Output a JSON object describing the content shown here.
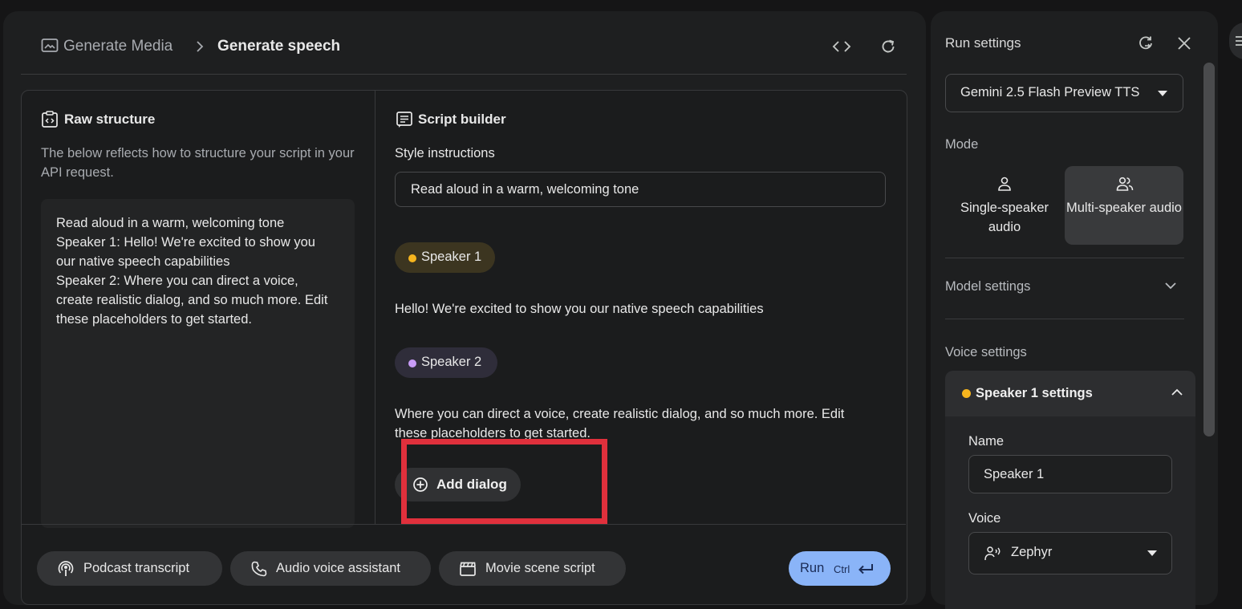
{
  "breadcrumb": {
    "parent": "Generate Media",
    "current": "Generate speech"
  },
  "raw_structure": {
    "title": "Raw structure",
    "description": "The below reflects how to structure your script in your API request.",
    "content_lines": [
      "Read aloud in a warm, welcoming tone",
      "Speaker 1: Hello! We're excited to show you our native speech capabilities",
      "Speaker 2: Where you can direct a voice, create realistic dialog, and so much more. Edit these placeholders to get started."
    ]
  },
  "script_builder": {
    "title": "Script builder",
    "style_label": "Style instructions",
    "style_value": "Read aloud in a warm, welcoming tone",
    "dialogs": [
      {
        "speaker": "Speaker 1",
        "dot_color": "#f6b51e",
        "text": "Hello! We're excited to show you our native speech capabilities"
      },
      {
        "speaker": "Speaker 2",
        "dot_color": "#c89cf7",
        "text": "Where you can direct a voice, create realistic dialog, and so much more. Edit these placeholders to get started."
      }
    ],
    "add_dialog_label": "Add dialog"
  },
  "presets": [
    {
      "label": "Podcast transcript",
      "icon": "podcast-icon"
    },
    {
      "label": "Audio voice assistant",
      "icon": "phone-icon"
    },
    {
      "label": "Movie scene script",
      "icon": "clapperboard-icon"
    }
  ],
  "run": {
    "label": "Run",
    "shortcut": "Ctrl",
    "color": "#8ab4f8"
  },
  "run_settings": {
    "title": "Run settings",
    "model": "Gemini 2.5 Flash Preview TTS",
    "mode_label": "Mode",
    "modes": [
      {
        "label": "Single-speaker audio",
        "selected": false
      },
      {
        "label": "Multi-speaker audio",
        "selected": true
      }
    ],
    "model_settings_label": "Model settings",
    "voice_settings_label": "Voice settings",
    "speaker_settings": {
      "title": "Speaker 1 settings",
      "name_label": "Name",
      "name_value": "Speaker 1",
      "voice_label": "Voice",
      "voice_value": "Zephyr"
    }
  },
  "annotation": {
    "color": "#e0303c"
  }
}
